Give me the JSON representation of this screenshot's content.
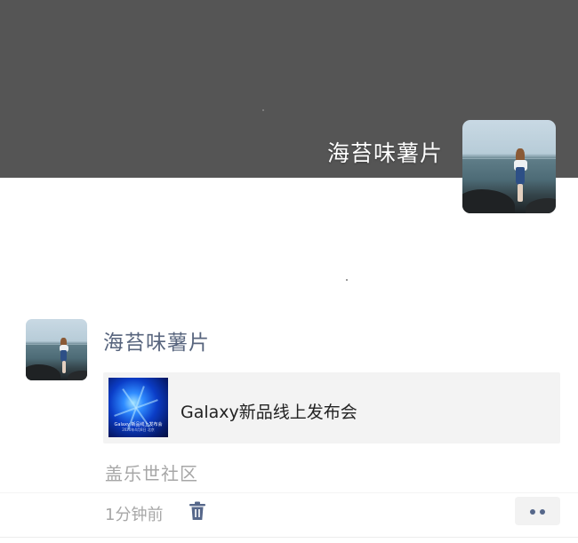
{
  "cover": {
    "background_color": "#555555",
    "user_name": "海苔味薯片",
    "avatar_icon": "avatar-photo-girl-seaside"
  },
  "post": {
    "author": "海苔味薯片",
    "avatar_icon": "avatar-photo-girl-seaside",
    "link_card": {
      "title": "Galaxy新品线上发布会",
      "thumbnail_icon": "galaxy-event-thumbnail",
      "thumbnail_text": "Galaxy 新品线上发布会",
      "thumbnail_subtext": "2020年4月8日 北京"
    },
    "source": "盖乐世社区",
    "time": "1分钟前",
    "delete_icon": "trash-icon",
    "more_icon": "more-dots-icon"
  },
  "colors": {
    "name_link": "#58657e",
    "meta_text": "#a7a7a7",
    "card_bg": "#f3f3f3",
    "accent_dots": "#56678a"
  }
}
